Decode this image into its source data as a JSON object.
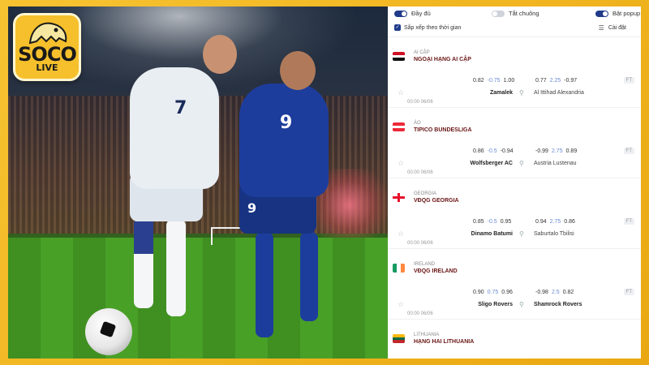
{
  "brand": {
    "name": "SOCO",
    "sub": "LIVE"
  },
  "hero": {
    "jersey_left": "7",
    "jersey_right": "9"
  },
  "toolbar": {
    "toggle_full": "Đầy đủ",
    "toggle_mute": "Tắt chuông",
    "toggle_popup": "Bật popup",
    "sort_label": "Sắp xếp theo thời gian",
    "settings_label": "Cài đặt"
  },
  "leagues": [
    {
      "country": "AI CẬP",
      "name": "NGOẠI HẠNG AI CẬP",
      "odds_left": [
        "0.82",
        "-0.75",
        "1.00"
      ],
      "odds_right": [
        "0.77",
        "2.25",
        "-0.97"
      ],
      "status": "FT",
      "time": "00:00 06/06",
      "home": "Zamalek",
      "away": "Al Ittihad Alexandria",
      "flag": "egypt"
    },
    {
      "country": "ÁO",
      "name": "TIPICO BUNDESLIGA",
      "odds_left": [
        "0.86",
        "-0.5",
        "-0.94"
      ],
      "odds_right": [
        "-0.99",
        "2.75",
        "0.89"
      ],
      "status": "FT",
      "time": "00:00 06/06",
      "home": "Wolfsberger AC",
      "away": "Austria Lustenau",
      "flag": "austria"
    },
    {
      "country": "GEORGIA",
      "name": "VĐQG GEORGIA",
      "odds_left": [
        "0.85",
        "-0.5",
        "0.95"
      ],
      "odds_right": [
        "0.94",
        "2.75",
        "0.86"
      ],
      "status": "FT",
      "time": "00:00 06/06",
      "home": "Dinamo Batumi",
      "away": "Saburtalo Tbilisi",
      "flag": "georgia"
    },
    {
      "country": "IRELAND",
      "name": "VĐQG IRELAND",
      "odds_left": [
        "0.90",
        "0.75",
        "0.96"
      ],
      "odds_right": [
        "-0.98",
        "2.5",
        "0.82"
      ],
      "status": "FT",
      "time": "00:00 06/06",
      "home": "Sligo Rovers",
      "away": "Shamrock Rovers",
      "flag": "ireland"
    },
    {
      "country": "LITHUANIA",
      "name": "HẠNG HAI LITHUANIA",
      "flag": "lithuania"
    }
  ]
}
